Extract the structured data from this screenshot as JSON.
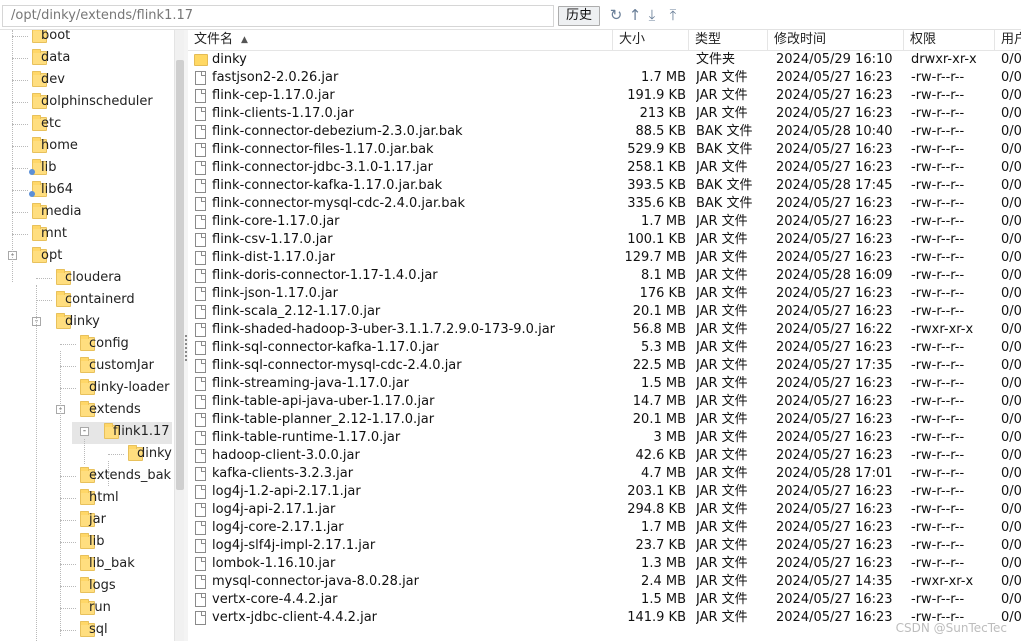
{
  "toolbar": {
    "path": "/opt/dinky/extends/flink1.17",
    "history_label": "历史",
    "icons": [
      "refresh-icon",
      "up-directory-icon",
      "download-icon",
      "upload-icon"
    ]
  },
  "tree": {
    "items": [
      {
        "label": "boot"
      },
      {
        "label": "data"
      },
      {
        "label": "dev"
      },
      {
        "label": "dolphinscheduler"
      },
      {
        "label": "etc"
      },
      {
        "label": "home"
      },
      {
        "label": "lib"
      },
      {
        "label": "lib64"
      },
      {
        "label": "media"
      },
      {
        "label": "mnt"
      },
      {
        "label": "opt"
      },
      {
        "label": "cloudera"
      },
      {
        "label": "containerd"
      },
      {
        "label": "dinky"
      },
      {
        "label": "config"
      },
      {
        "label": "customJar"
      },
      {
        "label": "dinky-loader"
      },
      {
        "label": "extends"
      },
      {
        "label": "flink1.17"
      },
      {
        "label": "dinky"
      },
      {
        "label": "extends_bak"
      },
      {
        "label": "html"
      },
      {
        "label": "jar"
      },
      {
        "label": "lib"
      },
      {
        "label": "lib_bak"
      },
      {
        "label": "logs"
      },
      {
        "label": "run"
      },
      {
        "label": "sql"
      }
    ],
    "expanded_toggle": "-"
  },
  "list": {
    "headers": {
      "name": "文件名",
      "size": "大小",
      "type": "类型",
      "modified": "修改时间",
      "perm": "权限",
      "user": "用户"
    },
    "rows": [
      {
        "name": "dinky",
        "size": "",
        "type": "文件夹",
        "modified": "2024/05/29 16:10",
        "perm": "drwxr-xr-x",
        "user": "0/0",
        "icon": "folder"
      },
      {
        "name": "fastjson2-2.0.26.jar",
        "size": "1.7 MB",
        "type": "JAR 文件",
        "modified": "2024/05/27 16:23",
        "perm": "-rw-r--r--",
        "user": "0/0",
        "icon": "file"
      },
      {
        "name": "flink-cep-1.17.0.jar",
        "size": "191.9 KB",
        "type": "JAR 文件",
        "modified": "2024/05/27 16:23",
        "perm": "-rw-r--r--",
        "user": "0/0",
        "icon": "file"
      },
      {
        "name": "flink-clients-1.17.0.jar",
        "size": "213 KB",
        "type": "JAR 文件",
        "modified": "2024/05/27 16:23",
        "perm": "-rw-r--r--",
        "user": "0/0",
        "icon": "file"
      },
      {
        "name": "flink-connector-debezium-2.3.0.jar.bak",
        "size": "88.5 KB",
        "type": "BAK 文件",
        "modified": "2024/05/28 10:40",
        "perm": "-rw-r--r--",
        "user": "0/0",
        "icon": "file"
      },
      {
        "name": "flink-connector-files-1.17.0.jar.bak",
        "size": "529.9 KB",
        "type": "BAK 文件",
        "modified": "2024/05/27 16:23",
        "perm": "-rw-r--r--",
        "user": "0/0",
        "icon": "file"
      },
      {
        "name": "flink-connector-jdbc-3.1.0-1.17.jar",
        "size": "258.1 KB",
        "type": "JAR 文件",
        "modified": "2024/05/27 16:23",
        "perm": "-rw-r--r--",
        "user": "0/0",
        "icon": "file"
      },
      {
        "name": "flink-connector-kafka-1.17.0.jar.bak",
        "size": "393.5 KB",
        "type": "BAK 文件",
        "modified": "2024/05/28 17:45",
        "perm": "-rw-r--r--",
        "user": "0/0",
        "icon": "file"
      },
      {
        "name": "flink-connector-mysql-cdc-2.4.0.jar.bak",
        "size": "335.6 KB",
        "type": "BAK 文件",
        "modified": "2024/05/27 16:23",
        "perm": "-rw-r--r--",
        "user": "0/0",
        "icon": "file"
      },
      {
        "name": "flink-core-1.17.0.jar",
        "size": "1.7 MB",
        "type": "JAR 文件",
        "modified": "2024/05/27 16:23",
        "perm": "-rw-r--r--",
        "user": "0/0",
        "icon": "file"
      },
      {
        "name": "flink-csv-1.17.0.jar",
        "size": "100.1 KB",
        "type": "JAR 文件",
        "modified": "2024/05/27 16:23",
        "perm": "-rw-r--r--",
        "user": "0/0",
        "icon": "file"
      },
      {
        "name": "flink-dist-1.17.0.jar",
        "size": "129.7 MB",
        "type": "JAR 文件",
        "modified": "2024/05/27 16:23",
        "perm": "-rw-r--r--",
        "user": "0/0",
        "icon": "file"
      },
      {
        "name": "flink-doris-connector-1.17-1.4.0.jar",
        "size": "8.1 MB",
        "type": "JAR 文件",
        "modified": "2024/05/28 16:09",
        "perm": "-rw-r--r--",
        "user": "0/0",
        "icon": "file"
      },
      {
        "name": "flink-json-1.17.0.jar",
        "size": "176 KB",
        "type": "JAR 文件",
        "modified": "2024/05/27 16:23",
        "perm": "-rw-r--r--",
        "user": "0/0",
        "icon": "file"
      },
      {
        "name": "flink-scala_2.12-1.17.0.jar",
        "size": "20.1 MB",
        "type": "JAR 文件",
        "modified": "2024/05/27 16:23",
        "perm": "-rw-r--r--",
        "user": "0/0",
        "icon": "file"
      },
      {
        "name": "flink-shaded-hadoop-3-uber-3.1.1.7.2.9.0-173-9.0.jar",
        "size": "56.8 MB",
        "type": "JAR 文件",
        "modified": "2024/05/27 16:22",
        "perm": "-rwxr-xr-x",
        "user": "0/0",
        "icon": "file"
      },
      {
        "name": "flink-sql-connector-kafka-1.17.0.jar",
        "size": "5.3 MB",
        "type": "JAR 文件",
        "modified": "2024/05/27 16:23",
        "perm": "-rw-r--r--",
        "user": "0/0",
        "icon": "file"
      },
      {
        "name": "flink-sql-connector-mysql-cdc-2.4.0.jar",
        "size": "22.5 MB",
        "type": "JAR 文件",
        "modified": "2024/05/27 17:35",
        "perm": "-rw-r--r--",
        "user": "0/0",
        "icon": "file"
      },
      {
        "name": "flink-streaming-java-1.17.0.jar",
        "size": "1.5 MB",
        "type": "JAR 文件",
        "modified": "2024/05/27 16:23",
        "perm": "-rw-r--r--",
        "user": "0/0",
        "icon": "file"
      },
      {
        "name": "flink-table-api-java-uber-1.17.0.jar",
        "size": "14.7 MB",
        "type": "JAR 文件",
        "modified": "2024/05/27 16:23",
        "perm": "-rw-r--r--",
        "user": "0/0",
        "icon": "file"
      },
      {
        "name": "flink-table-planner_2.12-1.17.0.jar",
        "size": "20.1 MB",
        "type": "JAR 文件",
        "modified": "2024/05/27 16:23",
        "perm": "-rw-r--r--",
        "user": "0/0",
        "icon": "file"
      },
      {
        "name": "flink-table-runtime-1.17.0.jar",
        "size": "3 MB",
        "type": "JAR 文件",
        "modified": "2024/05/27 16:23",
        "perm": "-rw-r--r--",
        "user": "0/0",
        "icon": "file"
      },
      {
        "name": "hadoop-client-3.0.0.jar",
        "size": "42.6 KB",
        "type": "JAR 文件",
        "modified": "2024/05/27 16:23",
        "perm": "-rw-r--r--",
        "user": "0/0",
        "icon": "file"
      },
      {
        "name": "kafka-clients-3.2.3.jar",
        "size": "4.7 MB",
        "type": "JAR 文件",
        "modified": "2024/05/28 17:01",
        "perm": "-rw-r--r--",
        "user": "0/0",
        "icon": "file"
      },
      {
        "name": "log4j-1.2-api-2.17.1.jar",
        "size": "203.1 KB",
        "type": "JAR 文件",
        "modified": "2024/05/27 16:23",
        "perm": "-rw-r--r--",
        "user": "0/0",
        "icon": "file"
      },
      {
        "name": "log4j-api-2.17.1.jar",
        "size": "294.8 KB",
        "type": "JAR 文件",
        "modified": "2024/05/27 16:23",
        "perm": "-rw-r--r--",
        "user": "0/0",
        "icon": "file"
      },
      {
        "name": "log4j-core-2.17.1.jar",
        "size": "1.7 MB",
        "type": "JAR 文件",
        "modified": "2024/05/27 16:23",
        "perm": "-rw-r--r--",
        "user": "0/0",
        "icon": "file"
      },
      {
        "name": "log4j-slf4j-impl-2.17.1.jar",
        "size": "23.7 KB",
        "type": "JAR 文件",
        "modified": "2024/05/27 16:23",
        "perm": "-rw-r--r--",
        "user": "0/0",
        "icon": "file"
      },
      {
        "name": "lombok-1.16.10.jar",
        "size": "1.3 MB",
        "type": "JAR 文件",
        "modified": "2024/05/27 16:23",
        "perm": "-rw-r--r--",
        "user": "0/0",
        "icon": "file"
      },
      {
        "name": "mysql-connector-java-8.0.28.jar",
        "size": "2.4 MB",
        "type": "JAR 文件",
        "modified": "2024/05/27 14:35",
        "perm": "-rwxr-xr-x",
        "user": "0/0",
        "icon": "file"
      },
      {
        "name": "vertx-core-4.4.2.jar",
        "size": "1.5 MB",
        "type": "JAR 文件",
        "modified": "2024/05/27 16:23",
        "perm": "-rw-r--r--",
        "user": "0/0",
        "icon": "file"
      },
      {
        "name": "vertx-jdbc-client-4.4.2.jar",
        "size": "141.9 KB",
        "type": "JAR 文件",
        "modified": "2024/05/27 16:23",
        "perm": "-rw-r--r--",
        "user": "0/0",
        "icon": "file"
      }
    ]
  },
  "watermark": "CSDN @SunTecTec"
}
